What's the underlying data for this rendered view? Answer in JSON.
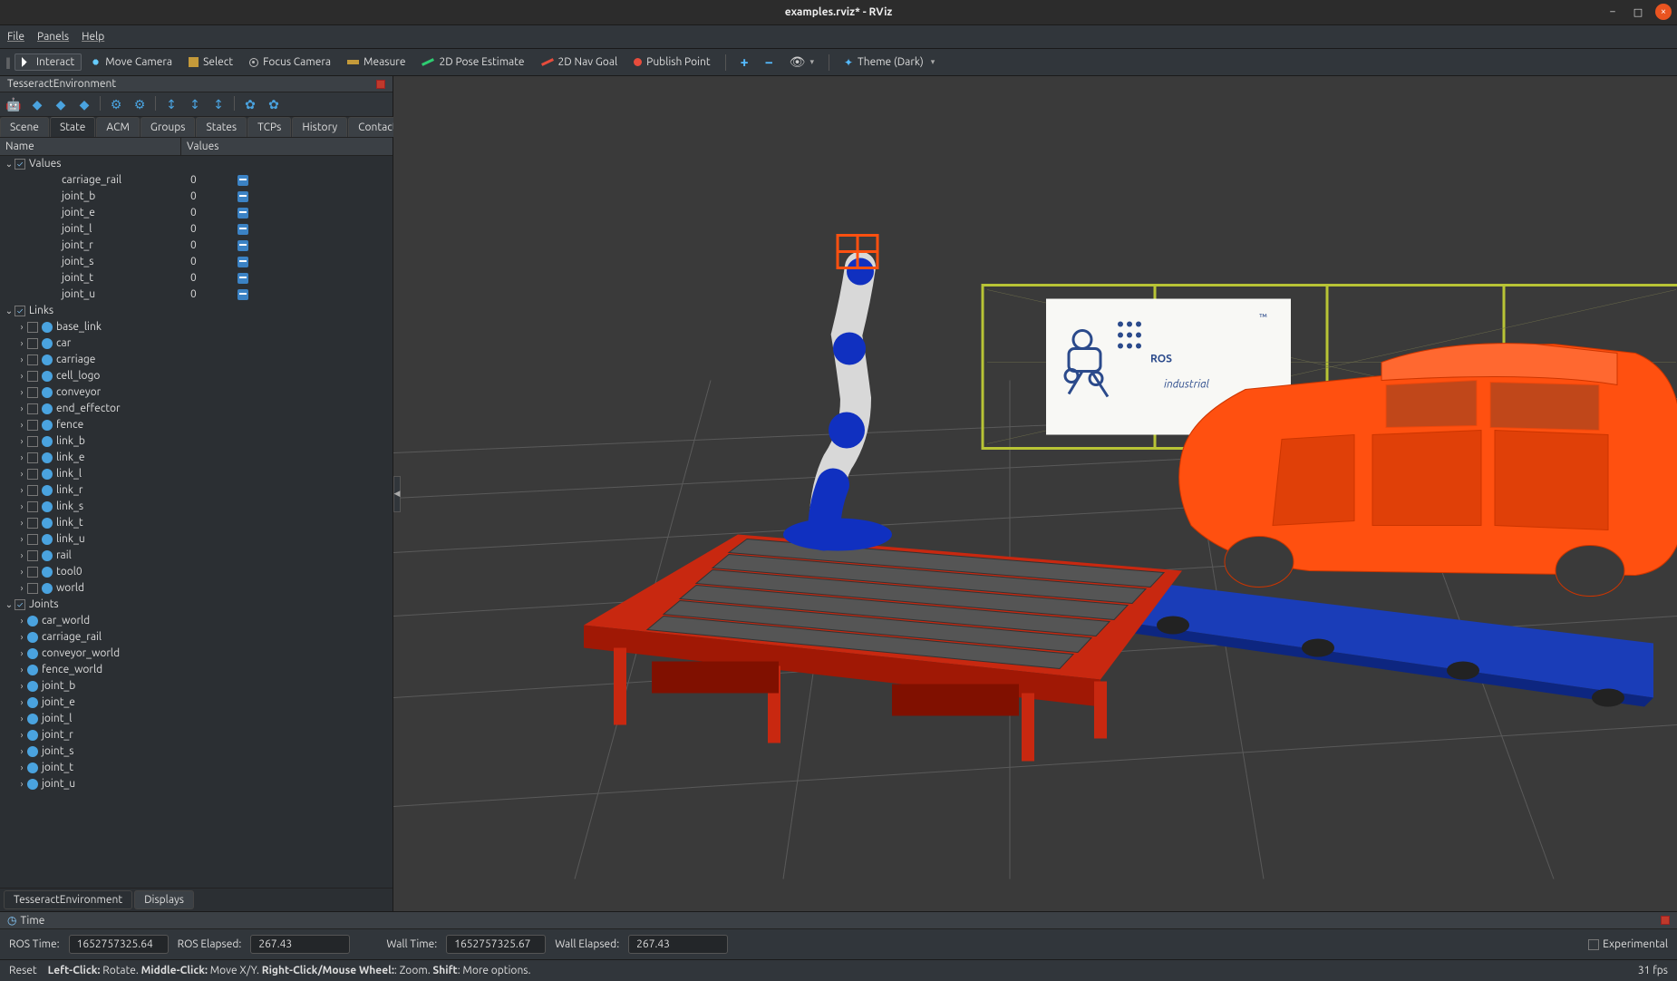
{
  "window": {
    "title": "examples.rviz* - RViz"
  },
  "menubar": [
    "File",
    "Panels",
    "Help"
  ],
  "toolbar": {
    "interact": "Interact",
    "move": "Move Camera",
    "select": "Select",
    "focus": "Focus Camera",
    "measure": "Measure",
    "pose": "2D Pose Estimate",
    "nav": "2D Nav Goal",
    "publish": "Publish Point",
    "theme": "Theme (Dark)"
  },
  "panel": {
    "title": "TesseractEnvironment",
    "tabs": [
      "Scene",
      "State",
      "ACM",
      "Groups",
      "States",
      "TCPs",
      "History",
      "Contacts"
    ],
    "active_tab": "State",
    "header": {
      "name": "Name",
      "values": "Values"
    },
    "values_group": "Values",
    "values": [
      {
        "name": "carriage_rail",
        "val": "0"
      },
      {
        "name": "joint_b",
        "val": "0"
      },
      {
        "name": "joint_e",
        "val": "0"
      },
      {
        "name": "joint_l",
        "val": "0"
      },
      {
        "name": "joint_r",
        "val": "0"
      },
      {
        "name": "joint_s",
        "val": "0"
      },
      {
        "name": "joint_t",
        "val": "0"
      },
      {
        "name": "joint_u",
        "val": "0"
      }
    ],
    "links_group": "Links",
    "links": [
      "base_link",
      "car",
      "carriage",
      "cell_logo",
      "conveyor",
      "end_effector",
      "fence",
      "link_b",
      "link_e",
      "link_l",
      "link_r",
      "link_s",
      "link_t",
      "link_u",
      "rail",
      "tool0",
      "world"
    ],
    "joints_group": "Joints",
    "joints": [
      "car_world",
      "carriage_rail",
      "conveyor_world",
      "fence_world",
      "joint_b",
      "joint_e",
      "joint_l",
      "joint_r",
      "joint_s",
      "joint_t",
      "joint_u"
    ],
    "bottom_tabs": [
      "TesseractEnvironment",
      "Displays"
    ],
    "bottom_active": "TesseractEnvironment"
  },
  "viewport": {
    "logo_main": "ROS",
    "logo_sub": "industrial",
    "logo_tm": "™"
  },
  "time": {
    "title": "Time",
    "ros_time_label": "ROS Time:",
    "ros_time": "1652757325.64",
    "ros_elapsed_label": "ROS Elapsed:",
    "ros_elapsed": "267.43",
    "wall_time_label": "Wall Time:",
    "wall_time": "1652757325.67",
    "wall_elapsed_label": "Wall Elapsed:",
    "wall_elapsed": "267.43",
    "experimental": "Experimental"
  },
  "status": {
    "reset": "Reset",
    "hints": "Left-Click: Rotate. Middle-Click: Move X/Y. Right-Click/Mouse Wheel:: Zoom. Shift: More options.",
    "fps": "31 fps"
  }
}
